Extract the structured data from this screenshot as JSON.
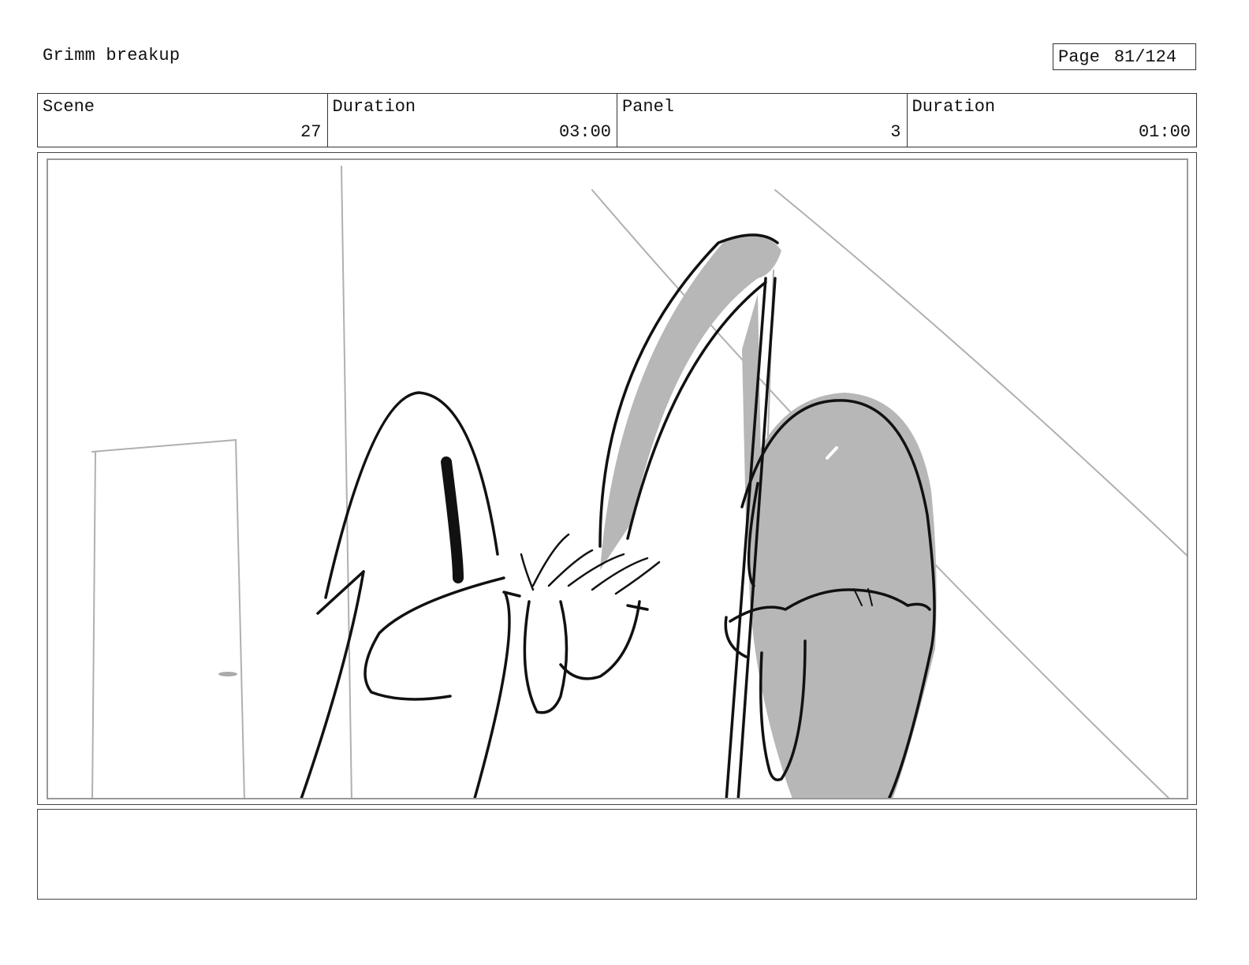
{
  "header": {
    "title": "Grimm breakup",
    "page_label": "Page",
    "page_value": "81/124"
  },
  "info": {
    "scene_label": "Scene",
    "scene_value": "27",
    "scene_duration_label": "Duration",
    "scene_duration_value": "03:00",
    "panel_label": "Panel",
    "panel_value": "3",
    "panel_duration_label": "Duration",
    "panel_duration_value": "01:00"
  },
  "notes": {
    "text": ""
  }
}
